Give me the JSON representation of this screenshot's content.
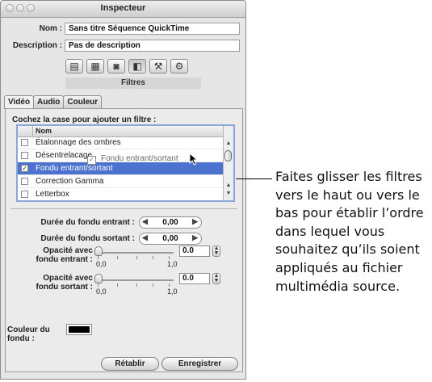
{
  "window": {
    "title": "Inspecteur"
  },
  "form": {
    "name_label": "Nom :",
    "name_value": "Sans titre  Séquence QuickTime",
    "desc_label": "Description :",
    "desc_value": "Pas de description"
  },
  "toolbar": {
    "icons": [
      "list-icon",
      "film-icon",
      "camera-icon",
      "layers-icon",
      "tools-icon",
      "gear-icon"
    ],
    "selected_icon": "layers-icon",
    "label": "Filtres"
  },
  "tabs": [
    "Vidéo",
    "Audio",
    "Couleur"
  ],
  "active_tab": "Vidéo",
  "filters": {
    "instruction": "Cochez la case pour ajouter un filtre :",
    "column_header": "Nom",
    "rows": [
      {
        "label": "Étalonnage des ombres",
        "checked": false,
        "selected": false
      },
      {
        "label": "Désentrelacage",
        "checked": false,
        "selected": false
      },
      {
        "label": "Fondu entrant/sortant",
        "checked": true,
        "selected": true
      },
      {
        "label": "Correction Gamma",
        "checked": false,
        "selected": false
      },
      {
        "label": "Letterbox",
        "checked": false,
        "selected": false
      }
    ],
    "drag_ghost": "Fondu entrant/sortant"
  },
  "params": {
    "fade_in_label": "Durée du fondu entrant :",
    "fade_in_value": "0,00",
    "fade_out_label": "Durée du fondu sortant :",
    "fade_out_value": "0,00",
    "opacity_in_label_1": "Opacité avec",
    "opacity_in_label_2": "fondu entrant :",
    "opacity_in_value": "0.0",
    "opacity_in_level": 0.0,
    "opacity_out_label_1": "Opacité avec",
    "opacity_out_label_2": "fondu sortant :",
    "opacity_out_value": "0.0",
    "opacity_out_level": 0.0,
    "slider_min_label": "0,0",
    "slider_max_label": "1,0",
    "fade_color_label": "Couleur du fondu :",
    "fade_color": "#000000"
  },
  "buttons": {
    "reset": "Rétablir",
    "save": "Enregistrer"
  },
  "callout": "Faites glisser les filtres vers le haut ou vers le bas pour établir l’ordre dans lequel vous souhaitez qu’ils soient appliqués au fichier multimédia source."
}
